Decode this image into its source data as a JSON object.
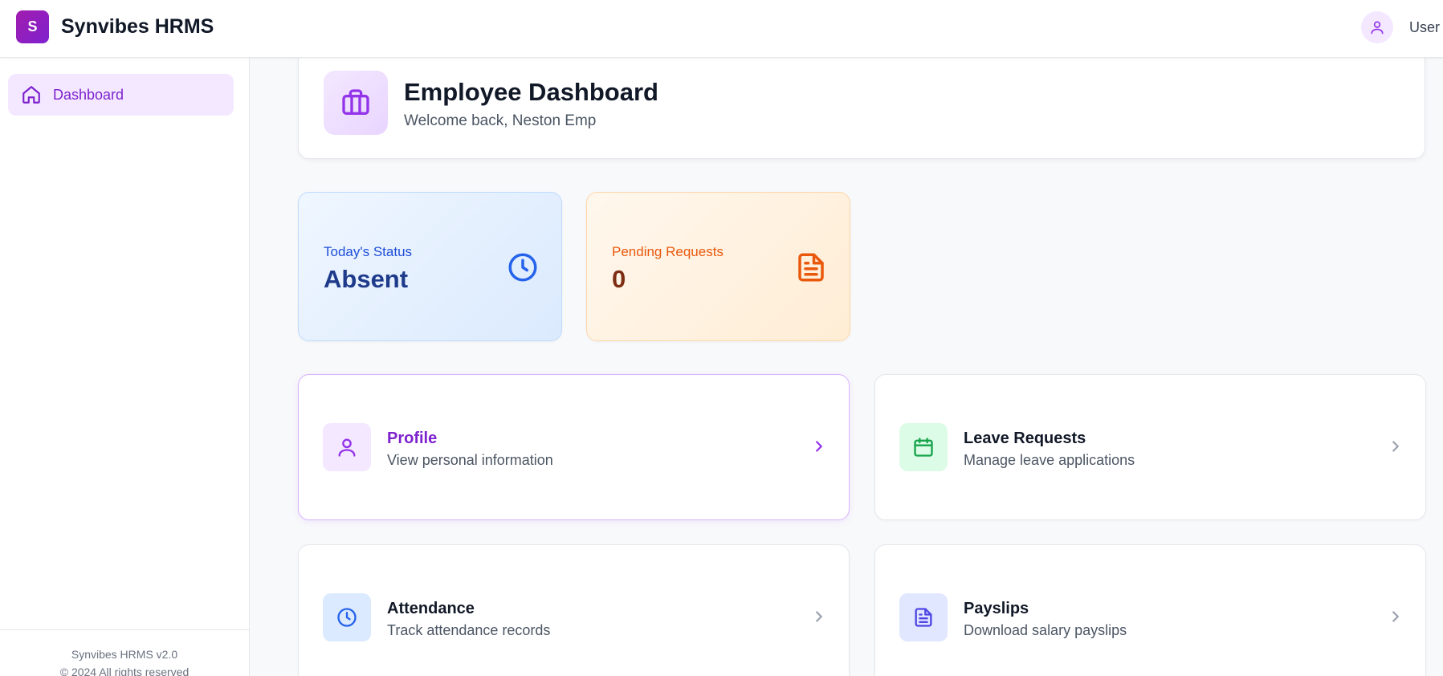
{
  "header": {
    "logo_letter": "S",
    "app_title": "Synvibes HRMS",
    "user_label": "User"
  },
  "sidebar": {
    "items": [
      {
        "label": "Dashboard",
        "icon": "home-icon",
        "active": true
      }
    ],
    "footer": {
      "version": "Synvibes HRMS v2.0",
      "copyright": "© 2024 All rights reserved"
    }
  },
  "dashboard": {
    "title": "Employee Dashboard",
    "subtitle": "Welcome back, Neston Emp",
    "icon": "briefcase-icon"
  },
  "stats": {
    "status": {
      "label": "Today's Status",
      "value": "Absent",
      "icon": "clock-icon",
      "color": "#2563eb"
    },
    "pending": {
      "label": "Pending Requests",
      "value": "0",
      "icon": "document-icon",
      "color": "#ea580c"
    }
  },
  "actions": [
    {
      "title": "Profile",
      "desc": "View personal information",
      "icon": "user-icon",
      "color": "#9333ea"
    },
    {
      "title": "Leave Requests",
      "desc": "Manage leave applications",
      "icon": "calendar-icon",
      "color": "#16a34a"
    },
    {
      "title": "Attendance",
      "desc": "Track attendance records",
      "icon": "clock-icon",
      "color": "#2563eb"
    },
    {
      "title": "Payslips",
      "desc": "Download salary payslips",
      "icon": "document-icon",
      "color": "#4f46e5"
    }
  ]
}
